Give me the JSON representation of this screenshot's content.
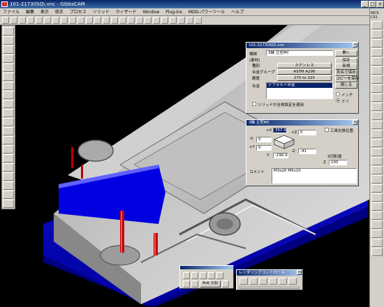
{
  "window": {
    "title": "101-21730SQ\\.vnc - GibbsCAM",
    "min": "_",
    "max": "□",
    "close": "×"
  },
  "menu": [
    "ファイル",
    "編集",
    "表示",
    "修正",
    "プロセス",
    "ソリッド",
    "ウィザード",
    "Window",
    "Plug-Ins",
    "MDD-パワーツール",
    "ヘルプ"
  ],
  "right_label": "WCS\nCS1",
  "machine_dialog": {
    "title": "101-21730SQ\\.vnc",
    "labels": {
      "machine": "機械",
      "stock": "(素材)",
      "type": "種別",
      "material_group": "合金グループ",
      "hardness": "硬度",
      "alloy": "合金"
    },
    "values": {
      "machine": "3軸 立型MC",
      "type": "ステンレス",
      "material_group": "ASTM A296",
      "hardness": "275 to 325",
      "alloy_selected": "デフォルト合金"
    },
    "buttons": [
      "開く",
      "保存",
      "新規",
      "別名で保存",
      "コピーを保存",
      "閉じる"
    ],
    "units": [
      "インチ",
      "ミリ"
    ],
    "units_selected": "ミリ",
    "checkbox_label": "ソリッドの全体設定を適用"
  },
  "origin_dialog": {
    "title": "3軸 立型MC",
    "fields": {
      "plus_x": "357.4",
      "plus_z": "0",
      "minus_x": "0",
      "plus_y": "0",
      "minus_z": "-41",
      "minus_y": "-190.9",
      "clearance": "100"
    },
    "labels": {
      "plus_x": "+X",
      "plus_z": "+Z",
      "minus_x": "-X",
      "plus_y": "+Y",
      "minus_z": "-Z",
      "minus_y": "-Y",
      "tool_change": "工具交換位置",
      "clearance": "Z切削速",
      "z": "Z",
      "comment": "コメント"
    },
    "comment_text": "M3x20 M5x10"
  },
  "bottom_toolbar": {
    "label": "Bolt 分割"
  },
  "render_panel": {
    "title": "レンダリングコントロール"
  },
  "colors": {
    "viewport_bg": "#000000",
    "base_blue": "#0000c8",
    "part_gray": "#b8b8b8",
    "selected_face": "#0000e0",
    "pin_red": "#c00000"
  }
}
